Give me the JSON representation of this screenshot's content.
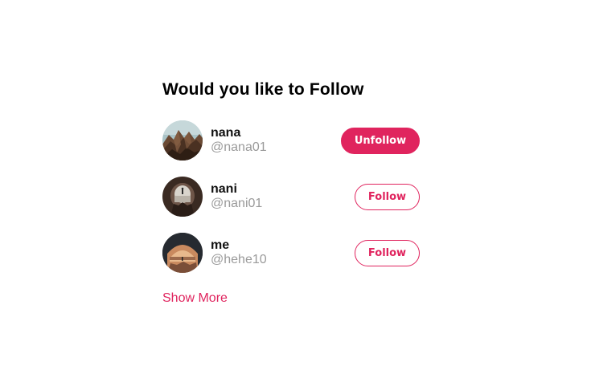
{
  "follow_panel": {
    "title": "Would you like to Follow",
    "users": [
      {
        "name": "nana",
        "handle": "@nana01",
        "button_label": "Unfollow",
        "following": true
      },
      {
        "name": "nani",
        "handle": "@nani01",
        "button_label": "Follow",
        "following": false
      },
      {
        "name": "me",
        "handle": "@hehe10",
        "button_label": "Follow",
        "following": false
      }
    ],
    "show_more_label": "Show More"
  },
  "colors": {
    "accent": "#e0245e",
    "handle_gray": "#9a9a9a",
    "background": "#ffffff"
  }
}
